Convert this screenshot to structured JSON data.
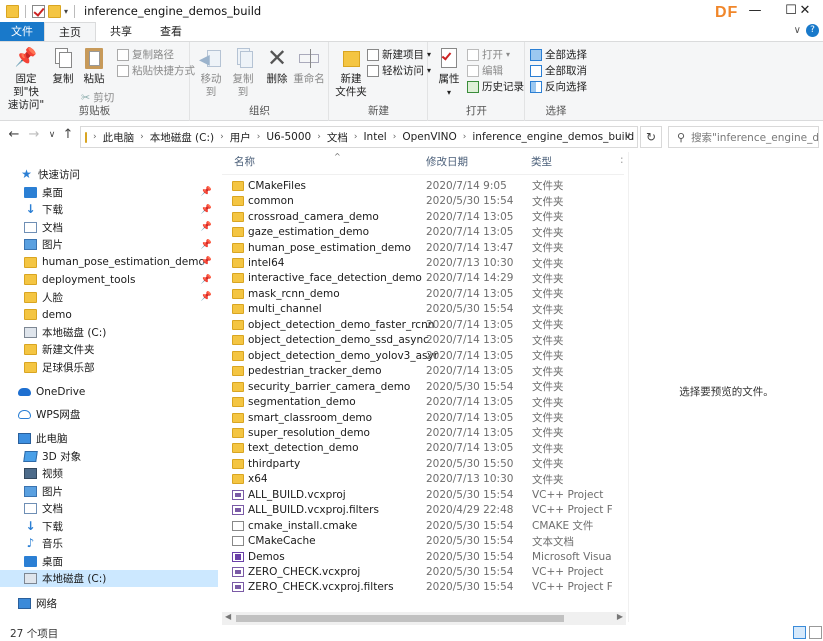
{
  "window": {
    "title": "inference_engine_demos_build",
    "watermark": "DF",
    "controls": {
      "minimize": "—",
      "maximize": "☐",
      "close": "✕"
    }
  },
  "ribbon_tabs": [
    "文件",
    "主页",
    "共享",
    "查看"
  ],
  "ribbon": {
    "clipboard": {
      "pin_label": "固定到\"快\n速访问\"",
      "copy": "复制",
      "paste": "粘贴",
      "copy_path": "复制路径",
      "paste_shortcut": "粘贴快捷方式",
      "cut": "剪切",
      "group": "剪贴板"
    },
    "organize": {
      "move_to": "移动到",
      "copy_to": "复制到",
      "delete": "删除",
      "rename": "重命名",
      "group": "组织"
    },
    "new": {
      "new_folder": "新建\n文件夹",
      "new_item": "新建项目",
      "easy_access": "轻松访问",
      "group": "新建"
    },
    "open": {
      "properties": "属性",
      "open": "打开",
      "edit": "编辑",
      "history": "历史记录",
      "group": "打开"
    },
    "select": {
      "select_all": "全部选择",
      "select_none": "全部取消",
      "invert": "反向选择",
      "group": "选择"
    }
  },
  "address": {
    "crumbs": [
      "此电脑",
      "本地磁盘 (C:)",
      "用户",
      "U6-5000",
      "文档",
      "Intel",
      "OpenVINO",
      "inference_engine_demos_build"
    ],
    "search_placeholder": "搜索\"inference_engine_de..."
  },
  "nav_pane": {
    "quick_access": "快速访问",
    "items": [
      {
        "label": "桌面",
        "icon": "desktop-icon",
        "pinned": true
      },
      {
        "label": "下载",
        "icon": "download-icon",
        "pinned": true
      },
      {
        "label": "文档",
        "icon": "documents-icon",
        "pinned": true
      },
      {
        "label": "图片",
        "icon": "pictures-icon",
        "pinned": true
      },
      {
        "label": "human_pose_estimation_demo",
        "icon": "folder-icon",
        "pinned": true
      },
      {
        "label": "deployment_tools",
        "icon": "folder-icon",
        "pinned": true
      },
      {
        "label": "人脸",
        "icon": "folder-icon",
        "pinned": true
      },
      {
        "label": "demo",
        "icon": "folder-icon",
        "pinned": false
      },
      {
        "label": "本地磁盘 (C:)",
        "icon": "drive-icon",
        "pinned": false
      },
      {
        "label": "新建文件夹",
        "icon": "folder-icon",
        "pinned": false
      },
      {
        "label": "足球俱乐部",
        "icon": "folder-icon",
        "pinned": false
      }
    ],
    "onedrive": "OneDrive",
    "wps": "WPS网盘",
    "this_pc": "此电脑",
    "pc_items": [
      {
        "label": "3D 对象",
        "icon": "3d-objects-icon"
      },
      {
        "label": "视频",
        "icon": "videos-icon"
      },
      {
        "label": "图片",
        "icon": "pictures-icon"
      },
      {
        "label": "文档",
        "icon": "documents-icon"
      },
      {
        "label": "下载",
        "icon": "download-icon"
      },
      {
        "label": "音乐",
        "icon": "music-icon"
      },
      {
        "label": "桌面",
        "icon": "desktop-icon"
      },
      {
        "label": "本地磁盘 (C:)",
        "icon": "drive-icon"
      }
    ],
    "network": "网络"
  },
  "columns": {
    "name": "名称",
    "date": "修改日期",
    "type": "类型"
  },
  "files": [
    {
      "name": "CMakeFiles",
      "date": "2020/7/14 9:05",
      "type": "文件夹",
      "kind": "folder"
    },
    {
      "name": "common",
      "date": "2020/5/30 15:54",
      "type": "文件夹",
      "kind": "folder"
    },
    {
      "name": "crossroad_camera_demo",
      "date": "2020/7/14 13:05",
      "type": "文件夹",
      "kind": "folder"
    },
    {
      "name": "gaze_estimation_demo",
      "date": "2020/7/14 13:05",
      "type": "文件夹",
      "kind": "folder"
    },
    {
      "name": "human_pose_estimation_demo",
      "date": "2020/7/14 13:47",
      "type": "文件夹",
      "kind": "folder"
    },
    {
      "name": "intel64",
      "date": "2020/7/13 10:30",
      "type": "文件夹",
      "kind": "folder"
    },
    {
      "name": "interactive_face_detection_demo",
      "date": "2020/7/14 14:29",
      "type": "文件夹",
      "kind": "folder"
    },
    {
      "name": "mask_rcnn_demo",
      "date": "2020/7/14 13:05",
      "type": "文件夹",
      "kind": "folder"
    },
    {
      "name": "multi_channel",
      "date": "2020/5/30 15:54",
      "type": "文件夹",
      "kind": "folder"
    },
    {
      "name": "object_detection_demo_faster_rcnn",
      "date": "2020/7/14 13:05",
      "type": "文件夹",
      "kind": "folder"
    },
    {
      "name": "object_detection_demo_ssd_async",
      "date": "2020/7/14 13:05",
      "type": "文件夹",
      "kind": "folder"
    },
    {
      "name": "object_detection_demo_yolov3_async",
      "date": "2020/7/14 13:05",
      "type": "文件夹",
      "kind": "folder"
    },
    {
      "name": "pedestrian_tracker_demo",
      "date": "2020/7/14 13:05",
      "type": "文件夹",
      "kind": "folder"
    },
    {
      "name": "security_barrier_camera_demo",
      "date": "2020/5/30 15:54",
      "type": "文件夹",
      "kind": "folder"
    },
    {
      "name": "segmentation_demo",
      "date": "2020/7/14 13:05",
      "type": "文件夹",
      "kind": "folder"
    },
    {
      "name": "smart_classroom_demo",
      "date": "2020/7/14 13:05",
      "type": "文件夹",
      "kind": "folder"
    },
    {
      "name": "super_resolution_demo",
      "date": "2020/7/14 13:05",
      "type": "文件夹",
      "kind": "folder"
    },
    {
      "name": "text_detection_demo",
      "date": "2020/7/14 13:05",
      "type": "文件夹",
      "kind": "folder"
    },
    {
      "name": "thirdparty",
      "date": "2020/5/30 15:50",
      "type": "文件夹",
      "kind": "folder"
    },
    {
      "name": "x64",
      "date": "2020/7/13 10:30",
      "type": "文件夹",
      "kind": "folder"
    },
    {
      "name": "ALL_BUILD.vcxproj",
      "date": "2020/5/30 15:54",
      "type": "VC++ Project",
      "kind": "vcx"
    },
    {
      "name": "ALL_BUILD.vcxproj.filters",
      "date": "2020/4/29 22:48",
      "type": "VC++ Project Fil...",
      "kind": "vcx"
    },
    {
      "name": "cmake_install.cmake",
      "date": "2020/5/30 15:54",
      "type": "CMAKE 文件",
      "kind": "txt"
    },
    {
      "name": "CMakeCache",
      "date": "2020/5/30 15:54",
      "type": "文本文档",
      "kind": "txt"
    },
    {
      "name": "Demos",
      "date": "2020/5/30 15:54",
      "type": "Microsoft Visual...",
      "kind": "sln"
    },
    {
      "name": "ZERO_CHECK.vcxproj",
      "date": "2020/5/30 15:54",
      "type": "VC++ Project",
      "kind": "vcx"
    },
    {
      "name": "ZERO_CHECK.vcxproj.filters",
      "date": "2020/5/30 15:54",
      "type": "VC++ Project Fil...",
      "kind": "vcx"
    }
  ],
  "preview_text": "选择要预览的文件。",
  "status": {
    "count": "27 个项目"
  },
  "colors": {
    "accent": "#1979ca",
    "folder": "#f4c542",
    "selection": "#cce8ff"
  }
}
